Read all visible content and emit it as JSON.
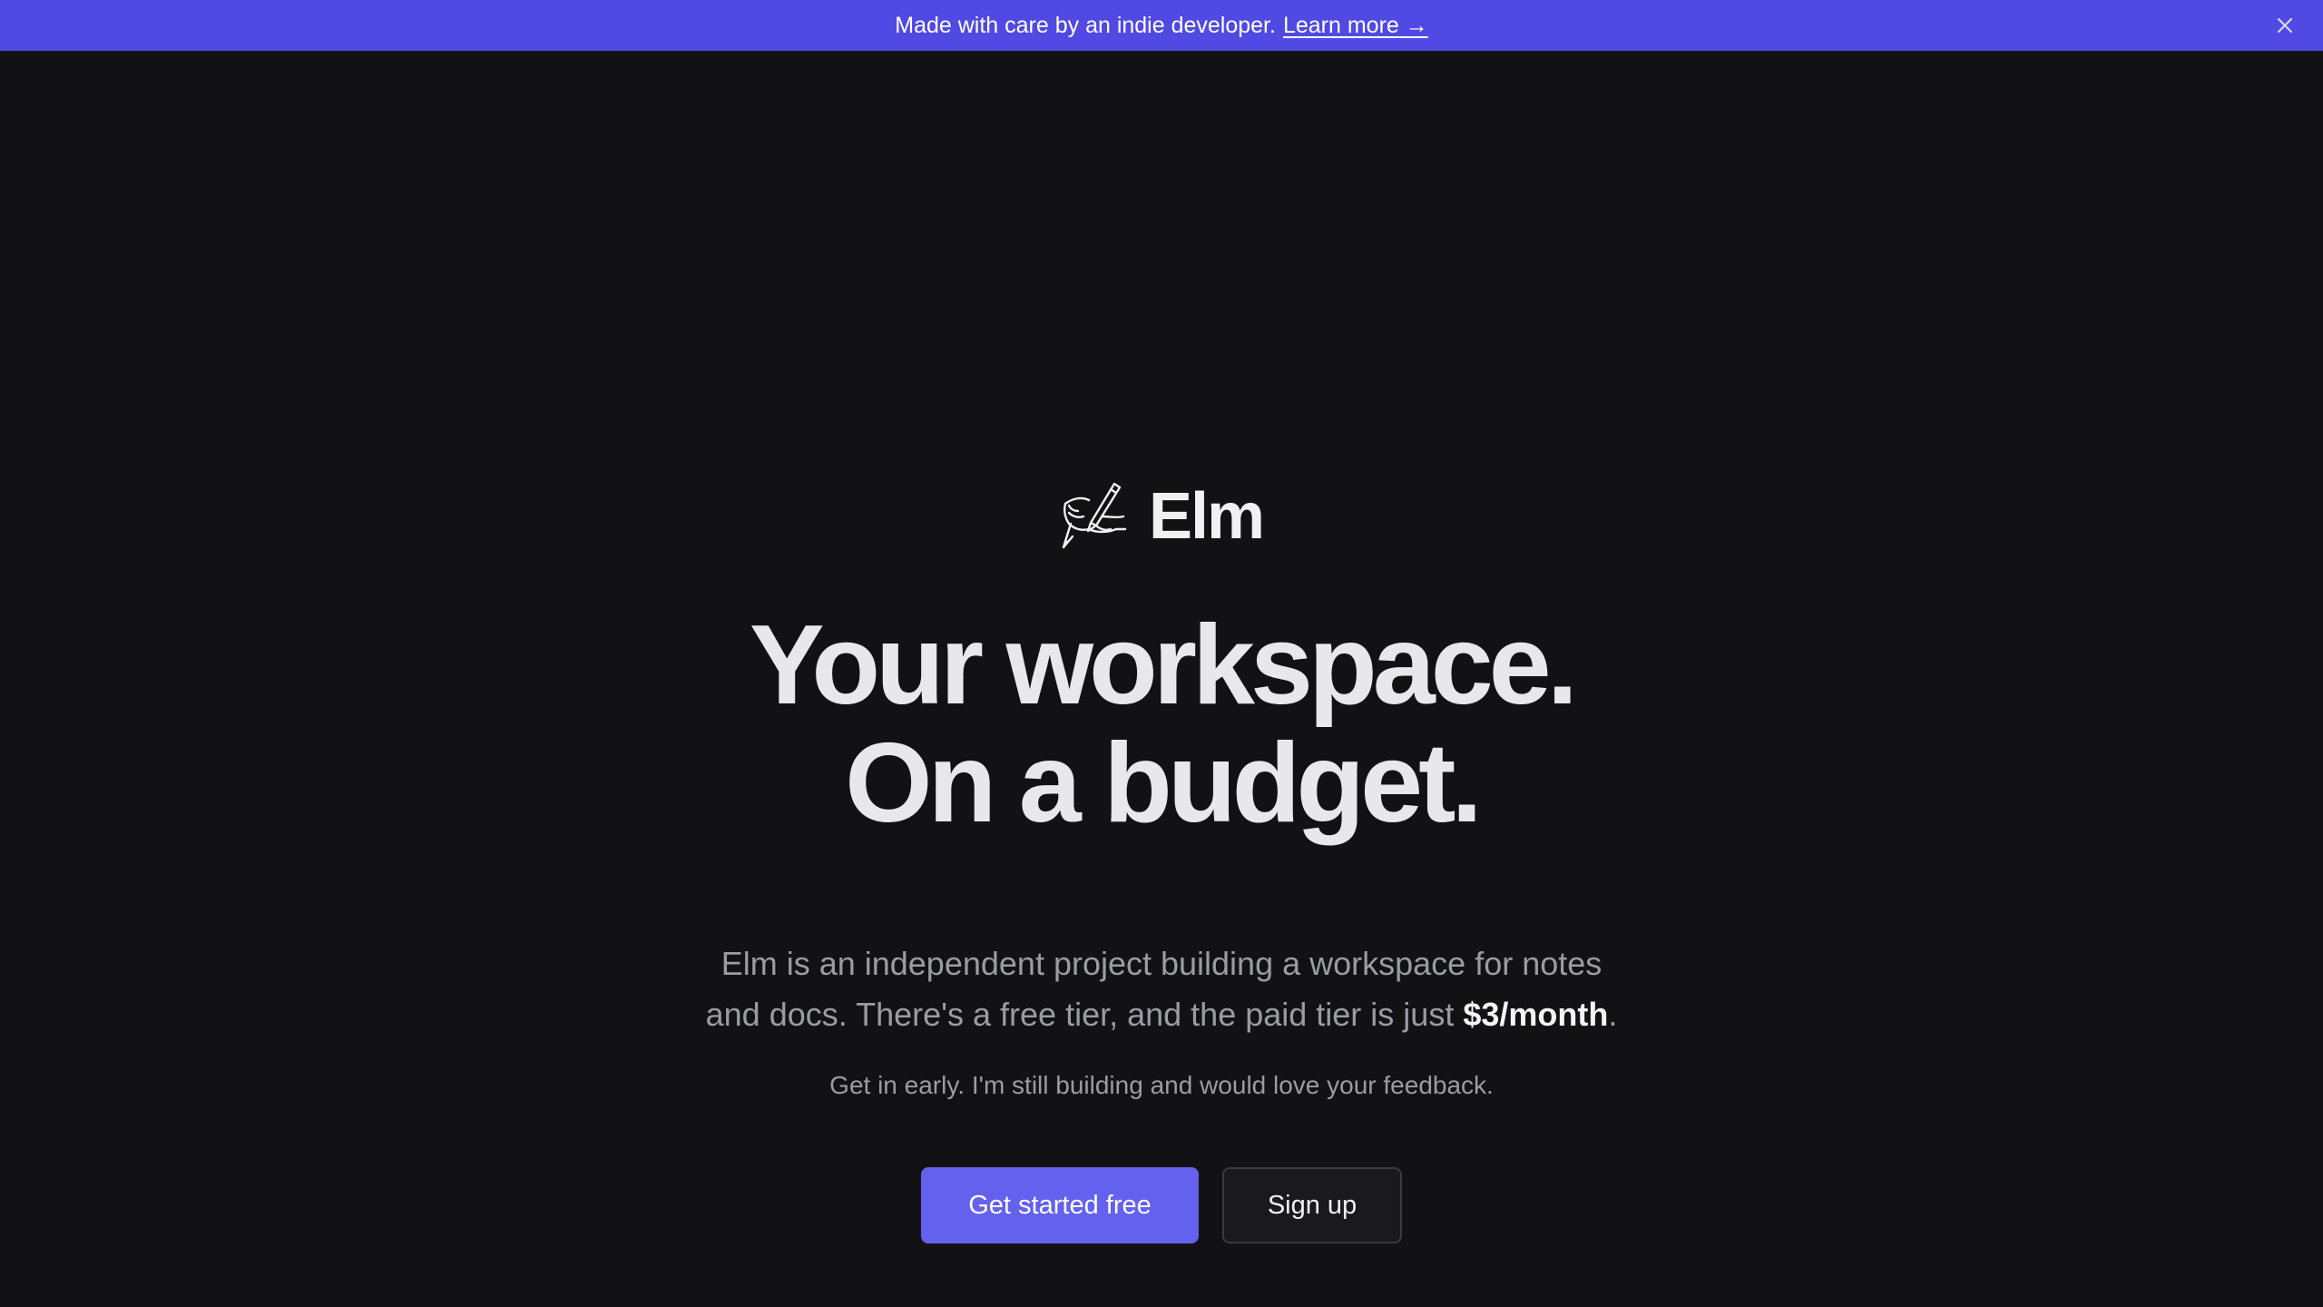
{
  "banner": {
    "text": "Made with care by an indie developer.",
    "link_label": "Learn more →",
    "close_icon": "close-icon",
    "background": "#5049e4"
  },
  "brand": {
    "logo_icon": "writing-hand-icon",
    "name": "Elm"
  },
  "hero": {
    "headline_line1": "Your workspace.",
    "headline_line2": "On a budget.",
    "subtitle_line1": "Elm is an independent project building a workspace for notes",
    "subtitle_line2_prefix": "and docs. There's a free tier, and the paid tier is just ",
    "subtitle_price": "$3/month",
    "subtitle_line2_suffix": ".",
    "note": "Get in early. I'm still building and would love your feedback."
  },
  "cta": {
    "primary_label": "Get started free",
    "secondary_label": "Sign up",
    "accent": "#6461ef"
  },
  "colors": {
    "background": "#121214",
    "text_primary": "#e8e8ec",
    "text_muted": "#9b9ba3"
  }
}
